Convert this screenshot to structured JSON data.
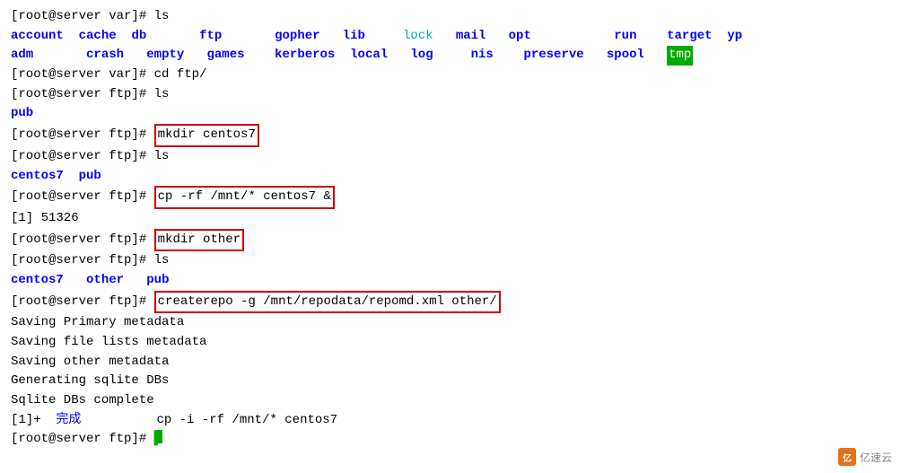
{
  "terminal": {
    "lines": [
      {
        "id": "line1",
        "type": "command",
        "prompt": "[root@server var]# ",
        "command": "ls"
      },
      {
        "id": "line2",
        "type": "ls-output-1",
        "items": [
          {
            "text": "account",
            "class": "blue"
          },
          {
            "text": "  "
          },
          {
            "text": "cache",
            "class": "blue"
          },
          {
            "text": "  "
          },
          {
            "text": "db",
            "class": "blue"
          },
          {
            "text": "       "
          },
          {
            "text": "ftp",
            "class": "blue"
          },
          {
            "text": "       "
          },
          {
            "text": "gopher",
            "class": "blue"
          },
          {
            "text": "   "
          },
          {
            "text": "lib",
            "class": "blue"
          },
          {
            "text": "     "
          },
          {
            "text": "lock",
            "class": "cyan"
          },
          {
            "text": "   "
          },
          {
            "text": "mail",
            "class": "blue"
          },
          {
            "text": "   "
          },
          {
            "text": "opt",
            "class": "blue"
          },
          {
            "text": "           "
          },
          {
            "text": "run",
            "class": "blue"
          },
          {
            "text": "    "
          },
          {
            "text": "target",
            "class": "blue"
          },
          {
            "text": "  "
          },
          {
            "text": "yp",
            "class": "blue"
          }
        ]
      },
      {
        "id": "line3",
        "type": "ls-output-2",
        "items": [
          {
            "text": "adm",
            "class": "blue"
          },
          {
            "text": "       "
          },
          {
            "text": "crash",
            "class": "blue"
          },
          {
            "text": "   "
          },
          {
            "text": "empty",
            "class": "blue"
          },
          {
            "text": "   "
          },
          {
            "text": "games",
            "class": "blue"
          },
          {
            "text": "    "
          },
          {
            "text": "kerberos",
            "class": "blue"
          },
          {
            "text": "  "
          },
          {
            "text": "local",
            "class": "blue"
          },
          {
            "text": "   "
          },
          {
            "text": "log",
            "class": "blue"
          },
          {
            "text": "     "
          },
          {
            "text": "nis",
            "class": "blue"
          },
          {
            "text": "    "
          },
          {
            "text": "preserve",
            "class": "blue"
          },
          {
            "text": "   "
          },
          {
            "text": "spool",
            "class": "blue"
          },
          {
            "text": "   "
          },
          {
            "text": "tmp",
            "class": "green-bg"
          }
        ]
      },
      {
        "id": "line4",
        "type": "command",
        "prompt": "[root@server var]# ",
        "command": "cd ftp/"
      },
      {
        "id": "line5",
        "type": "command",
        "prompt": "[root@server ftp]# ",
        "command": "ls"
      },
      {
        "id": "line6",
        "type": "output",
        "text": "pub",
        "class": "blue"
      },
      {
        "id": "line7",
        "type": "command-boxed",
        "prompt": "[root@server ftp]# ",
        "command": "mkdir centos7"
      },
      {
        "id": "line8",
        "type": "command",
        "prompt": "[root@server ftp]# ",
        "command": "ls"
      },
      {
        "id": "line9",
        "type": "ls-output-3",
        "items": [
          {
            "text": "centos7",
            "class": "blue"
          },
          {
            "text": "  "
          },
          {
            "text": "pub",
            "class": "blue"
          }
        ]
      },
      {
        "id": "line10",
        "type": "command-boxed",
        "prompt": "[root@server ftp]# ",
        "command": "cp -rf /mnt/* centos7 &"
      },
      {
        "id": "line11",
        "type": "output",
        "text": "[1] 51326",
        "class": "normal"
      },
      {
        "id": "line12",
        "type": "command-boxed",
        "prompt": "[root@server ftp]# ",
        "command": "mkdir other"
      },
      {
        "id": "line13",
        "type": "command",
        "prompt": "[root@server ftp]# ",
        "command": "ls"
      },
      {
        "id": "line14",
        "type": "ls-output-4",
        "items": [
          {
            "text": "centos7",
            "class": "blue"
          },
          {
            "text": "   "
          },
          {
            "text": "other",
            "class": "blue"
          },
          {
            "text": "   "
          },
          {
            "text": "pub",
            "class": "blue"
          }
        ]
      },
      {
        "id": "line15",
        "type": "command-boxed",
        "prompt": "[root@server ftp]# ",
        "command": "createrepo -g /mnt/repodata/repomd.xml other/"
      },
      {
        "id": "line16",
        "type": "output",
        "text": "Saving Primary metadata",
        "class": "normal"
      },
      {
        "id": "line17",
        "type": "output",
        "text": "Saving file lists metadata",
        "class": "normal"
      },
      {
        "id": "line18",
        "type": "output",
        "text": "Saving other metadata",
        "class": "normal"
      },
      {
        "id": "line19",
        "type": "output",
        "text": "Generating sqlite DBs",
        "class": "normal"
      },
      {
        "id": "line20",
        "type": "output",
        "text": "Sqlite DBs complete",
        "class": "normal"
      },
      {
        "id": "line21",
        "type": "completion",
        "text1": "[1]+  ",
        "text2": "完成",
        "text3": "          cp -i -rf /mnt/* centos7"
      },
      {
        "id": "line22",
        "type": "final-prompt",
        "prompt": "[root@server ftp]# "
      }
    ]
  },
  "watermark": {
    "text": "亿速云",
    "logo": "亿"
  }
}
